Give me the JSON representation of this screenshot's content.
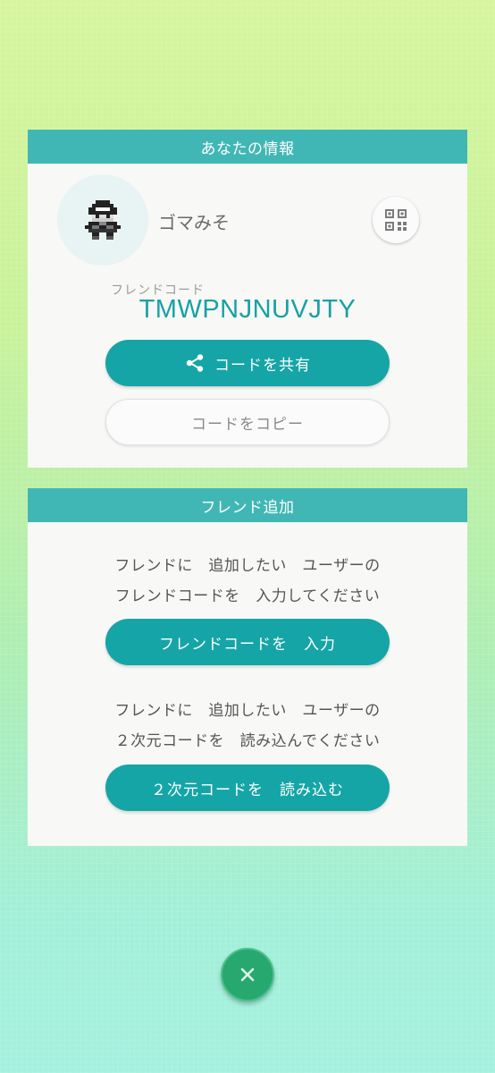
{
  "info_card": {
    "header": "あなたの情報",
    "user_name": "ゴマみそ",
    "friend_code_label": "フレンドコード",
    "friend_code": "TMWPNJNUVJTY",
    "share_button": "コードを共有",
    "copy_button": "コードをコピー"
  },
  "add_card": {
    "header": "フレンド追加",
    "instruction1_line1": "フレンドに　追加したい　ユーザーの",
    "instruction1_line2": "フレンドコードを　入力してください",
    "input_button": "フレンドコードを　入力",
    "instruction2_line1": "フレンドに　追加したい　ユーザーの",
    "instruction2_line2": "２次元コードを　読み込んでください",
    "scan_button": "２次元コードを　読み込む"
  },
  "colors": {
    "accent": "#16a5a6",
    "header": "#41b7b5",
    "close": "#26a86f"
  },
  "icons": [
    "trainer-avatar-icon",
    "qr-code-icon",
    "share-icon",
    "close-icon"
  ]
}
